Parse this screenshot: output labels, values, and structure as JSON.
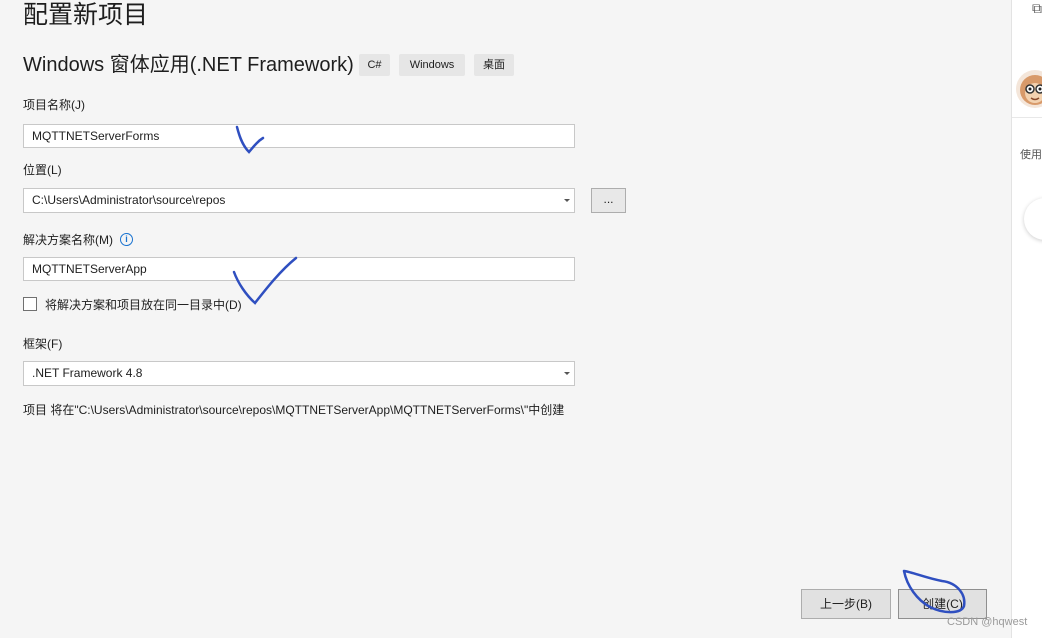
{
  "page": {
    "title": "配置新项目",
    "template_name": "Windows 窗体应用(.NET Framework)",
    "tags": [
      "C#",
      "Windows",
      "桌面"
    ]
  },
  "form": {
    "project_name": {
      "label": "项目名称(J)",
      "value": "MQTTNETServerForms"
    },
    "location": {
      "label": "位置(L)",
      "value": "C:\\Users\\Administrator\\source\\repos",
      "browse_label": "..."
    },
    "solution_name": {
      "label": "解决方案名称(M)",
      "value": "MQTTNETServerApp",
      "info_icon": "i"
    },
    "same_dir_checkbox": {
      "label": "将解决方案和项目放在同一目录中(D)",
      "checked": false
    },
    "framework": {
      "label": "框架(F)",
      "value": ".NET Framework 4.8"
    },
    "path_note": "项目 将在\"C:\\Users\\Administrator\\source\\repos\\MQTTNETServerApp\\MQTTNETServerForms\\\"中创建"
  },
  "buttons": {
    "back": "上一步(B)",
    "create": "创建(C)"
  },
  "sidebar": {
    "use_label": "使用"
  },
  "watermark": "CSDN @hqwest",
  "colors": {
    "annotation_ink": "#2f4fc0",
    "info_blue": "#1a73d0"
  }
}
